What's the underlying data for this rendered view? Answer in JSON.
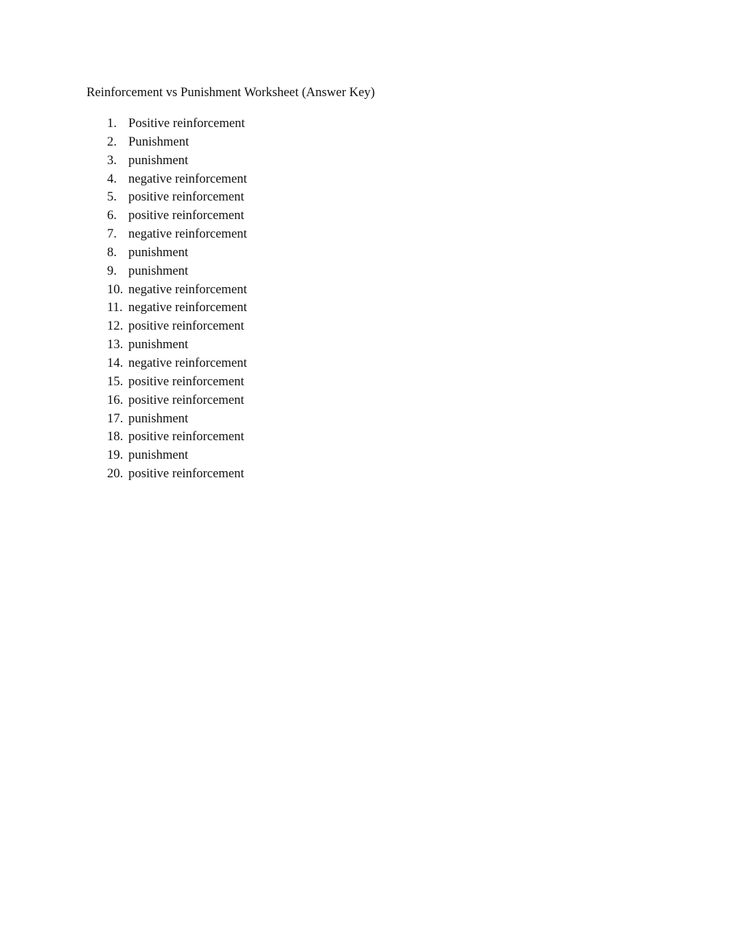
{
  "document": {
    "title": "Reinforcement vs Punishment Worksheet (Answer Key)",
    "answers": [
      {
        "number": "1.",
        "text": "Positive reinforcement"
      },
      {
        "number": "2.",
        "text": "Punishment"
      },
      {
        "number": "3.",
        "text": "punishment"
      },
      {
        "number": "4.",
        "text": "negative reinforcement"
      },
      {
        "number": "5.",
        "text": "positive reinforcement"
      },
      {
        "number": "6.",
        "text": "positive reinforcement"
      },
      {
        "number": "7.",
        "text": "negative reinforcement"
      },
      {
        "number": "8.",
        "text": "punishment"
      },
      {
        "number": "9.",
        "text": "punishment"
      },
      {
        "number": "10.",
        "text": "negative reinforcement"
      },
      {
        "number": "11.",
        "text": "negative reinforcement"
      },
      {
        "number": "12.",
        "text": "positive reinforcement"
      },
      {
        "number": "13.",
        "text": "punishment"
      },
      {
        "number": "14.",
        "text": "negative reinforcement"
      },
      {
        "number": "15.",
        "text": "positive reinforcement"
      },
      {
        "number": "16.",
        "text": "positive reinforcement"
      },
      {
        "number": "17.",
        "text": "punishment"
      },
      {
        "number": "18.",
        "text": "positive reinforcement"
      },
      {
        "number": "19.",
        "text": "punishment"
      },
      {
        "number": "20.",
        "text": "positive reinforcement"
      }
    ]
  }
}
